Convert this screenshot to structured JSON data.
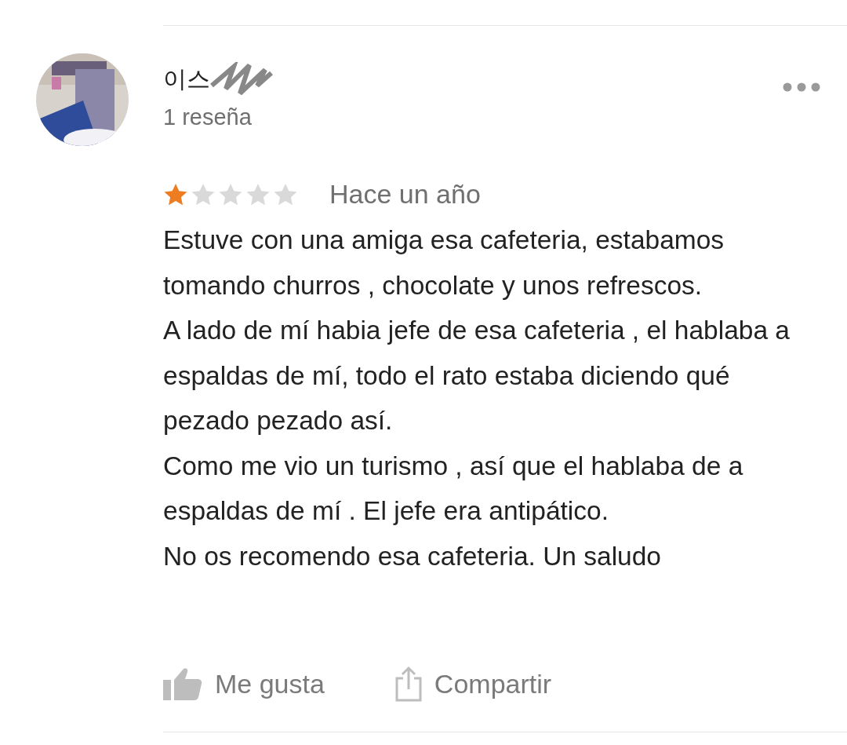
{
  "review": {
    "author": "이스",
    "review_count": "1 reseña",
    "stars": 1,
    "time": "Hace un año",
    "paragraphs": [
      "Estuve con una amiga esa cafeteria, estabamos tomando churros , chocolate y unos refrescos.",
      "A lado de mí habia jefe de esa cafeteria , el hablaba a espaldas de mí, todo el rato estaba diciendo qué pezado pezado así.",
      "Como me vio un turismo , así que el hablaba de a espaldas de mí . El jefe era antipático.",
      "No os recomendo esa cafeteria. Un saludo"
    ],
    "actions": [
      {
        "kind": "like",
        "label": "Me gusta"
      },
      {
        "kind": "share",
        "label": "Compartir"
      }
    ]
  }
}
